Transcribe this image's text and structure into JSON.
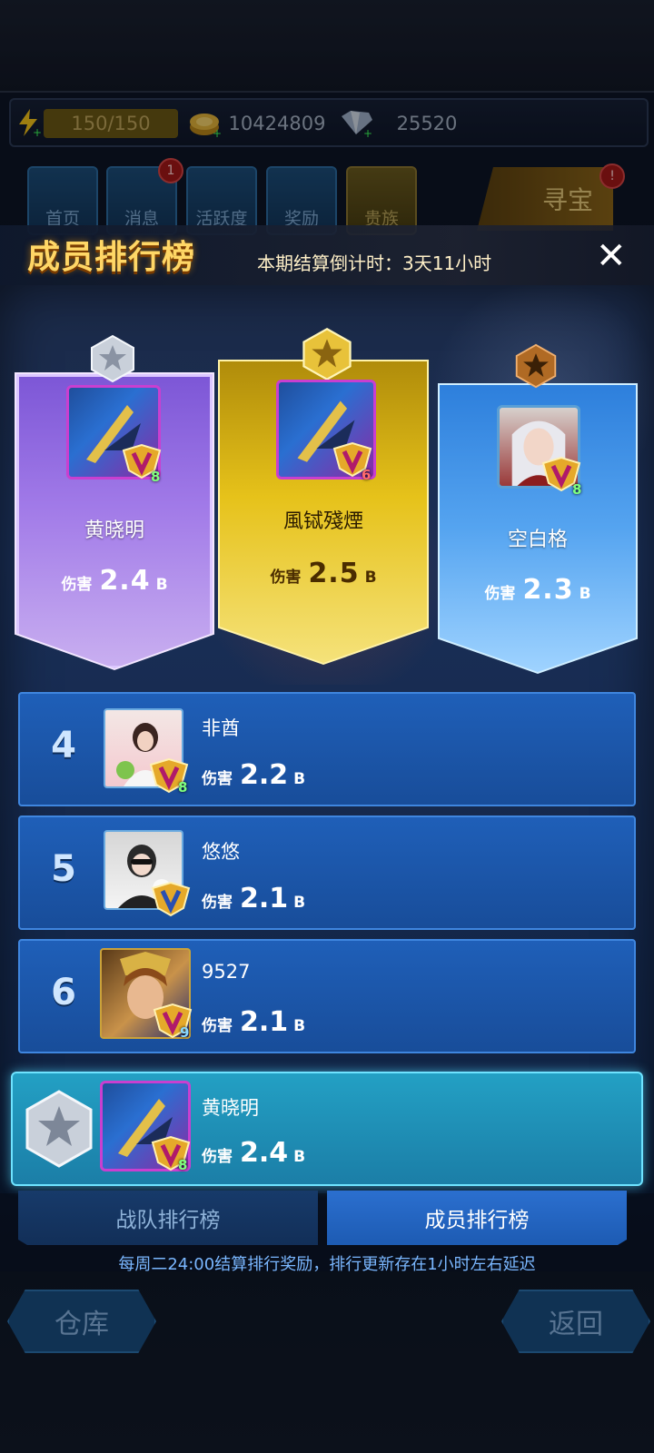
{
  "top": {
    "energy": "150/150",
    "gold": "10424809",
    "gems": "25520"
  },
  "tabs": [
    {
      "label": "首页",
      "badge": ""
    },
    {
      "label": "消息",
      "badge": "1"
    },
    {
      "label": "活跃度",
      "badge": ""
    },
    {
      "label": "奖励",
      "badge": ""
    },
    {
      "label": "贵族",
      "badge": ""
    }
  ],
  "treasure": {
    "label": "寻宝",
    "badge": "!"
  },
  "panel": {
    "title": "成员排行榜",
    "countdown": "本期结算倒计时：3天11小时",
    "close": "✕"
  },
  "podium": [
    {
      "rank": 2,
      "name": "黄晓明",
      "damage_label": "伤害",
      "damage": "2.4",
      "unit": "B",
      "vip": "8",
      "medal": "silver-star"
    },
    {
      "rank": 1,
      "name": "風铽殘煙",
      "damage_label": "伤害",
      "damage": "2.5",
      "unit": "B",
      "vip": "6",
      "medal": "gold-star"
    },
    {
      "rank": 3,
      "name": "空白格",
      "damage_label": "伤害",
      "damage": "2.3",
      "unit": "B",
      "vip": "8",
      "medal": "bronze-star"
    }
  ],
  "list": [
    {
      "rank": "4",
      "name": "非酋",
      "damage_label": "伤害",
      "damage": "2.2",
      "unit": "B",
      "vip": "8"
    },
    {
      "rank": "5",
      "name": "悠悠",
      "damage_label": "伤害",
      "damage": "2.1",
      "unit": "B",
      "vip": ""
    },
    {
      "rank": "6",
      "name": "9527",
      "damage_label": "伤害",
      "damage": "2.1",
      "unit": "B",
      "vip": "9"
    }
  ],
  "self": {
    "name": "黄晓明",
    "damage_label": "伤害",
    "damage": "2.4",
    "unit": "B",
    "vip": "8"
  },
  "bottom_tabs": {
    "team": "战队排行榜",
    "member": "成员排行榜"
  },
  "footnote": "每周二24:00结算排行奖励，排行更新存在1小时左右延迟",
  "bottom_buttons": {
    "warehouse": "仓库",
    "back": "返回"
  },
  "colors": {
    "title_gold": "#ffd766",
    "rank1": "#e6c21a",
    "rank2": "#a17ae8",
    "rank3": "#55a4f0",
    "row": "#1f5fb8",
    "self_row": "#23a0c4"
  }
}
